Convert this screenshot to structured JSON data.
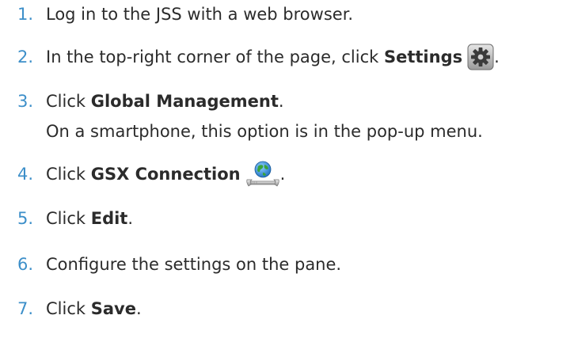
{
  "steps": [
    {
      "num": "1.",
      "text": "Log in to the JSS with a web browser."
    },
    {
      "num": "2.",
      "pre": "In the top-right corner of the page, click ",
      "bold": "Settings",
      "post": "."
    },
    {
      "num": "3.",
      "pre": "Click ",
      "bold": "Global Management",
      "post": ".",
      "note": "On a smartphone, this option is in the pop-up menu."
    },
    {
      "num": "4.",
      "pre": "Click ",
      "bold": "GSX Connection",
      "post": "."
    },
    {
      "num": "5.",
      "pre": "Click ",
      "bold": "Edit",
      "post": "."
    },
    {
      "num": "6.",
      "text": "Configure the settings on the pane."
    },
    {
      "num": "7.",
      "pre": "Click ",
      "bold": "Save",
      "post": "."
    }
  ],
  "icons": {
    "settings": "gear-icon",
    "gsx": "globe-wrench-icon"
  },
  "colors": {
    "number": "#3d8fc9",
    "text": "#2b2b2b"
  }
}
